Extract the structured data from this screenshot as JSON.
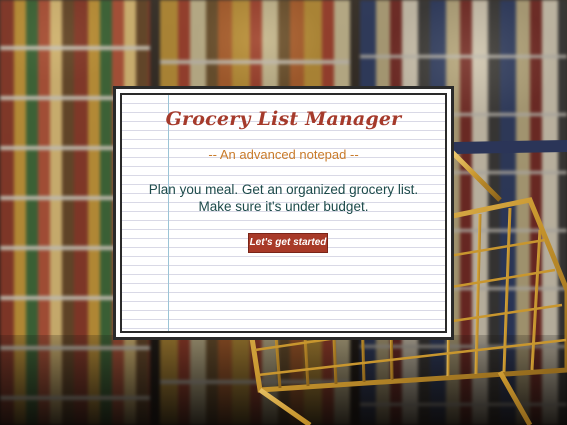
{
  "app": {
    "title": "Grocery List Manager",
    "subtitle": "-- An advanced notepad --",
    "tagline": "Plan you meal. Get an organized grocery list. Make sure it's under budget.",
    "start_button_label": "Let's get started"
  },
  "colors": {
    "title": "#a53a2b",
    "subtitle": "#c97b2a",
    "tagline": "#1c4a4a",
    "button_bg": "#a83a28",
    "margin_line": "#9bc4d6"
  },
  "background": {
    "scene": "supermarket-aisle-with-shopping-cart",
    "icon": "shopping-cart-icon"
  }
}
